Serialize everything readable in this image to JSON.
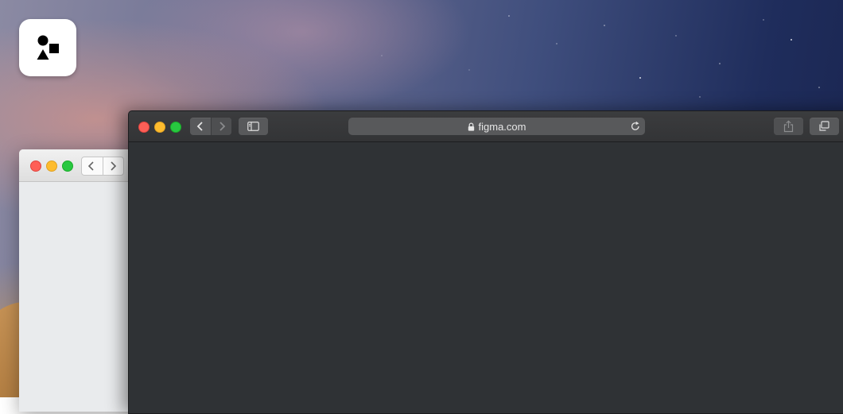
{
  "desktop": {
    "wallpaper": "mojave-night",
    "app_icon": {
      "icon": "shapes-icon"
    }
  },
  "back_window": {
    "theme": "light",
    "traffic_lights": [
      "close",
      "minimize",
      "zoom"
    ],
    "nav": {
      "back_icon": "chevron-left-icon",
      "forward_icon": "chevron-right-icon"
    }
  },
  "browser": {
    "theme": "dark",
    "traffic_lights": [
      "close",
      "minimize",
      "zoom"
    ],
    "address_bar": {
      "url": "figma.com",
      "secure_icon": "lock-icon",
      "reload_icon": "reload-icon"
    },
    "toolbar": {
      "back_icon": "chevron-left-icon",
      "forward_icon": "chevron-right-icon",
      "sidebar_icon": "sidebar-icon",
      "share_icon": "share-icon",
      "tabs_icon": "tab-overview-icon"
    },
    "content": {
      "state": "blank"
    }
  },
  "colors": {
    "close": "#fe5f57",
    "minimize": "#febc2e",
    "zoom": "#28c840",
    "browser_bg": "#2f3235",
    "toolbar_button": "#58595b"
  }
}
